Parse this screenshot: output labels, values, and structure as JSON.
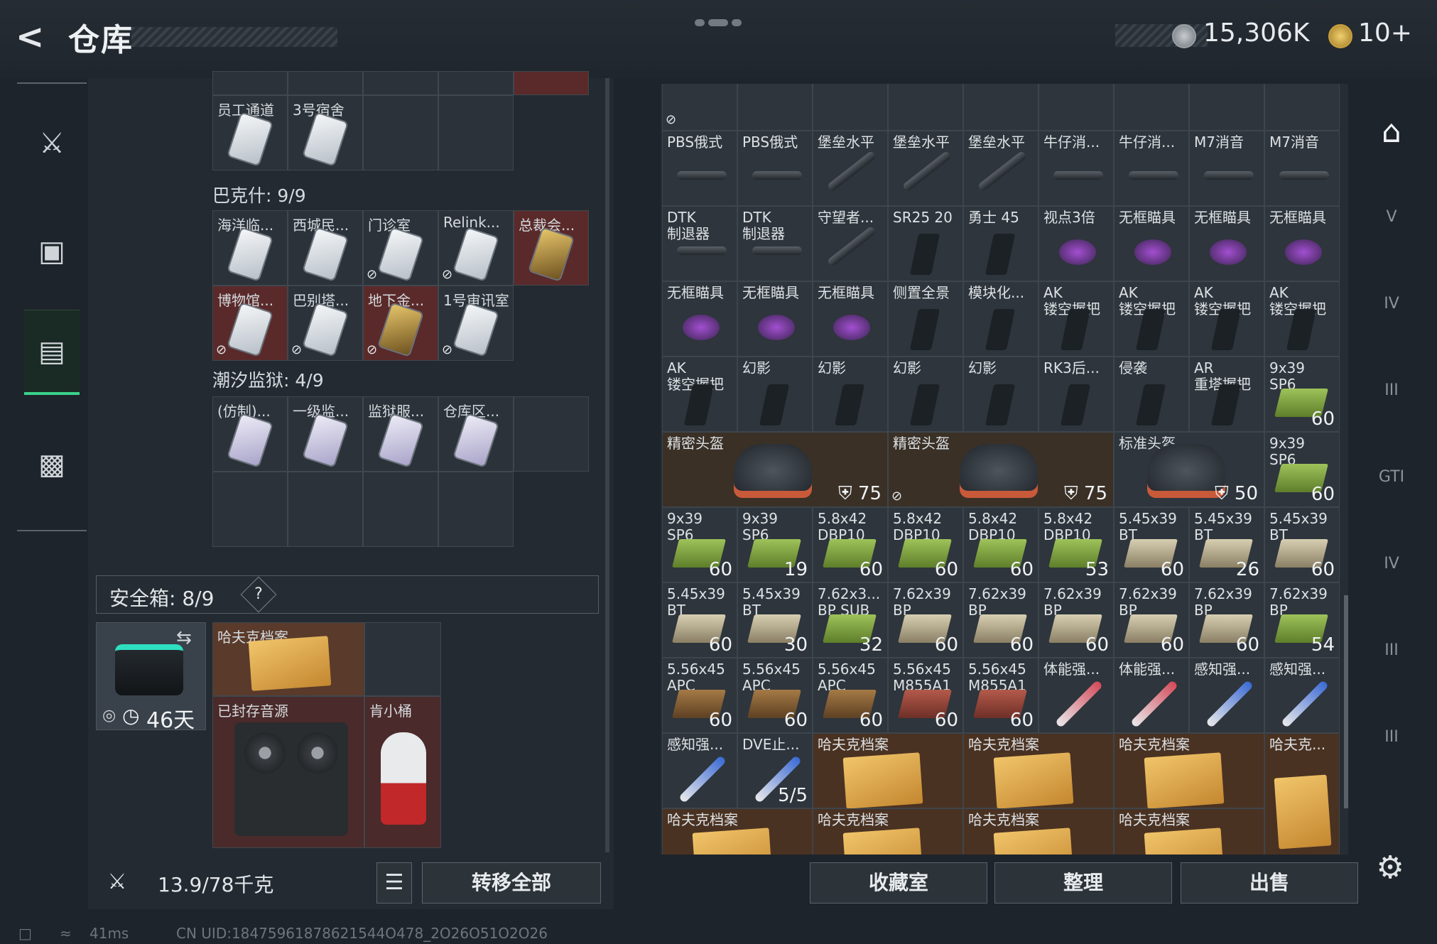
{
  "header": {
    "title": "仓库",
    "currency1": "15,306K",
    "currency2": "10+"
  },
  "sidebar": {
    "items": [
      "weapon",
      "backpack",
      "storage",
      "briefcase"
    ]
  },
  "left": {
    "top_row": [
      {
        "label": "员工通道"
      },
      {
        "label": "3号宿舍"
      }
    ],
    "bakeshi": {
      "label": "巴克什: 9/9",
      "row1": [
        "海洋临...",
        "西城民...",
        "门诊室",
        "Relink...",
        "总裁会..."
      ],
      "row2": [
        "博物馆...",
        "巴别塔...",
        "地下金...",
        "1号审讯室"
      ]
    },
    "chaoxi": {
      "label": "潮汐监狱: 4/9",
      "row1": [
        "(仿制)...",
        "一级监...",
        "监狱服...",
        "仓库区..."
      ]
    },
    "safe": {
      "label": "安全箱: 8/9",
      "help": "?",
      "days": "46天"
    },
    "safe_items": {
      "archive": "哈夫克档案",
      "tape": "已封存音源",
      "bucket": "肯小桶"
    },
    "weight": "13.9/78千克",
    "move_all": "转移全部"
  },
  "right": {
    "row1": [
      {
        "l": "PBS俄式",
        "t": "muzzle"
      },
      {
        "l": "PBS俄式",
        "t": "muzzle"
      },
      {
        "l": "堡垒水平",
        "t": "diag"
      },
      {
        "l": "堡垒水平",
        "t": "diag"
      },
      {
        "l": "堡垒水平",
        "t": "diag"
      },
      {
        "l": "牛仔消...",
        "t": "muzzle"
      },
      {
        "l": "牛仔消...",
        "t": "muzzle"
      },
      {
        "l": "M7消音",
        "t": "muzzle"
      },
      {
        "l": "M7消音",
        "t": "muzzle"
      }
    ],
    "row2": [
      {
        "l": "DTK\n制退器",
        "t": "muzzle"
      },
      {
        "l": "DTK\n制退器",
        "t": "muzzle"
      },
      {
        "l": "守望者...",
        "t": "diag"
      },
      {
        "l": "SR25 20",
        "t": "grip"
      },
      {
        "l": "勇士 45",
        "t": "grip"
      },
      {
        "l": "视点3倍",
        "t": "scope"
      },
      {
        "l": "无框瞄具",
        "t": "scope"
      },
      {
        "l": "无框瞄具",
        "t": "scope"
      },
      {
        "l": "无框瞄具",
        "t": "scope"
      }
    ],
    "row3": [
      {
        "l": "无框瞄具",
        "t": "scope"
      },
      {
        "l": "无框瞄具",
        "t": "scope"
      },
      {
        "l": "无框瞄具",
        "t": "scope"
      },
      {
        "l": "侧置全景",
        "t": "grip"
      },
      {
        "l": "模块化...",
        "t": "grip"
      },
      {
        "l": "AK\n镂空握把",
        "t": "grip"
      },
      {
        "l": "AK\n镂空握把",
        "t": "grip"
      },
      {
        "l": "AK\n镂空握把",
        "t": "grip"
      },
      {
        "l": "AK\n镂空握把",
        "t": "grip"
      }
    ],
    "row4": [
      {
        "l": "AK\n镂空握把",
        "t": "grip"
      },
      {
        "l": "幻影",
        "t": "grip"
      },
      {
        "l": "幻影",
        "t": "grip"
      },
      {
        "l": "幻影",
        "t": "grip"
      },
      {
        "l": "幻影",
        "t": "grip"
      },
      {
        "l": "RK3后...",
        "t": "grip"
      },
      {
        "l": "侵袭",
        "t": "grip"
      },
      {
        "l": "AR\n重塔握把",
        "t": "grip"
      },
      {
        "l": "9x39\nSP6",
        "t": "ammo-green",
        "c": "60"
      }
    ],
    "helmets": [
      {
        "l": "精密头盔",
        "v": "75"
      },
      {
        "l": "精密头盔",
        "v": "75"
      },
      {
        "l": "标准头盔",
        "v": "50"
      }
    ],
    "row5_last": {
      "l": "9x39\nSP6",
      "c": "60"
    },
    "row6": [
      {
        "l": "9x39\nSP6",
        "t": "ammo-green",
        "c": "60"
      },
      {
        "l": "9x39\nSP6",
        "t": "ammo-green",
        "c": "19"
      },
      {
        "l": "5.8x42\nDBP10",
        "t": "ammo-green",
        "c": "60"
      },
      {
        "l": "5.8x42\nDBP10",
        "t": "ammo-green",
        "c": "60"
      },
      {
        "l": "5.8x42\nDBP10",
        "t": "ammo-green",
        "c": "60"
      },
      {
        "l": "5.8x42\nDBP10",
        "t": "ammo-green",
        "c": "53"
      },
      {
        "l": "5.45x39\nBT",
        "t": "ammo-tan",
        "c": "60"
      },
      {
        "l": "5.45x39\nBT",
        "t": "ammo-tan",
        "c": "26"
      },
      {
        "l": "5.45x39\nBT",
        "t": "ammo-tan",
        "c": "60"
      }
    ],
    "row7": [
      {
        "l": "5.45x39\nBT",
        "t": "ammo-tan",
        "c": "60"
      },
      {
        "l": "5.45x39\nBT",
        "t": "ammo-tan",
        "c": "30"
      },
      {
        "l": "7.62x3...\nBP SUB",
        "t": "ammo-green",
        "c": "32"
      },
      {
        "l": "7.62x39\nBP",
        "t": "ammo-tan",
        "c": "60"
      },
      {
        "l": "7.62x39\nBP",
        "t": "ammo-tan",
        "c": "60"
      },
      {
        "l": "7.62x39\nBP",
        "t": "ammo-tan",
        "c": "60"
      },
      {
        "l": "7.62x39\nBP",
        "t": "ammo-tan",
        "c": "60"
      },
      {
        "l": "7.62x39\nBP",
        "t": "ammo-tan",
        "c": "60"
      },
      {
        "l": "7.62x39\nBP",
        "t": "ammo-green",
        "c": "54"
      }
    ],
    "row8": [
      {
        "l": "5.56x45\nAPC",
        "t": "ammo-brown",
        "c": "60"
      },
      {
        "l": "5.56x45\nAPC",
        "t": "ammo-brown",
        "c": "60"
      },
      {
        "l": "5.56x45\nAPC",
        "t": "ammo-brown",
        "c": "60"
      },
      {
        "l": "5.56x45\nM855A1",
        "t": "ammo-red",
        "c": "60"
      },
      {
        "l": "5.56x45\nM855A1",
        "t": "ammo-red",
        "c": "60"
      },
      {
        "l": "体能强...",
        "t": "syr-red"
      },
      {
        "l": "体能强...",
        "t": "syr-red"
      },
      {
        "l": "感知强...",
        "t": "syr-blue"
      },
      {
        "l": "感知强...",
        "t": "syr-blue"
      }
    ],
    "row9": {
      "a": "感知强...",
      "b": "DVE止...",
      "b_count": "5/5",
      "archives": [
        "哈夫克档案",
        "哈夫克档案",
        "哈夫克档案"
      ],
      "last": "哈夫克..."
    },
    "row10": [
      "哈夫克档案",
      "哈夫克档案",
      "哈夫克档案",
      "哈夫克档案"
    ],
    "buttons": [
      "收藏室",
      "整理",
      "出售"
    ]
  },
  "status": {
    "ping": "41ms",
    "uid": "CN UID:18475961878621544O478_2O26O51O2O26"
  }
}
